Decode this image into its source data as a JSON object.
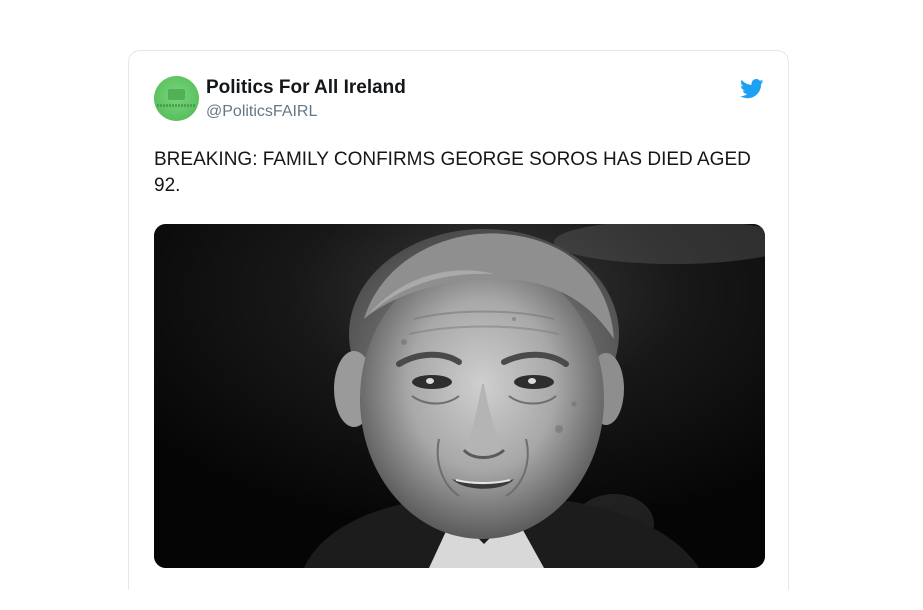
{
  "tweet": {
    "author": {
      "display_name": "Politics For All Ireland",
      "handle": "@PoliticsFAIRL",
      "avatar_icon": "green-logo-avatar"
    },
    "platform_icon": "twitter-bird-icon",
    "text": "BREAKING: FAMILY CONFIRMS GEORGE SOROS HAS DIED AGED 92.",
    "media": {
      "kind": "black-and-white portrait photo"
    }
  },
  "colors": {
    "twitter_blue": "#1da1f2",
    "text_primary": "#14171a",
    "text_secondary": "#657786",
    "card_border": "#e1e8ed",
    "avatar_green": "#5ec463"
  }
}
